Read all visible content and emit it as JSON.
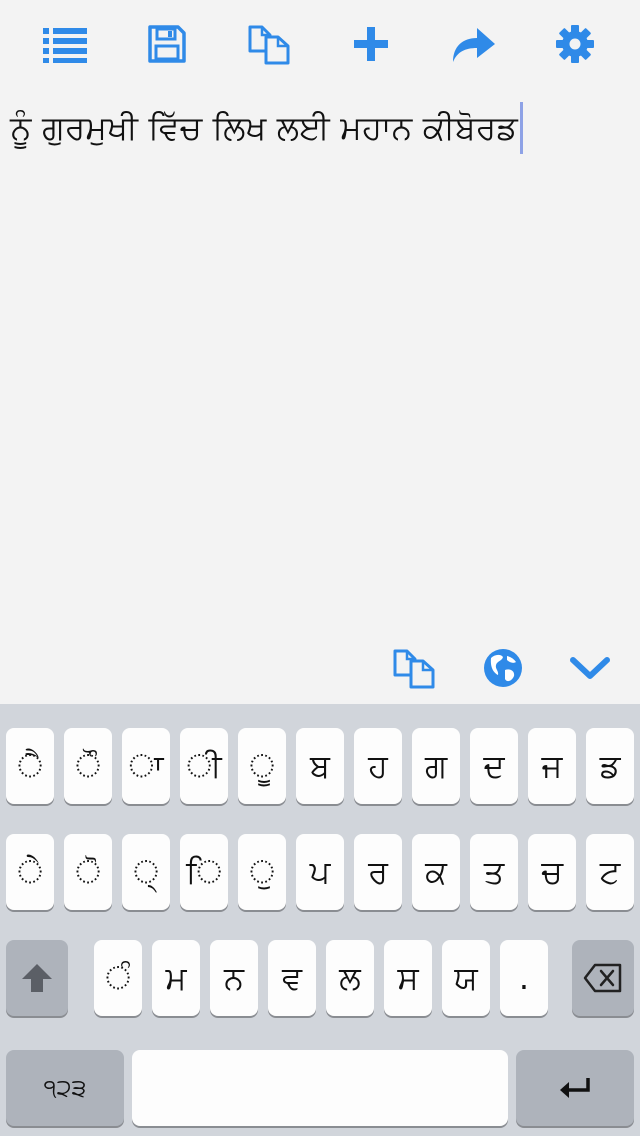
{
  "toolbar": {
    "icons": [
      "list-icon",
      "save-icon",
      "copy-icon",
      "plus-icon",
      "share-icon",
      "gear-icon"
    ],
    "accent": "#2f8ae8"
  },
  "editor": {
    "text": "ਨੂੰ ਗੁਰਮੁਖੀ ਵਿੱਚ ਲਿਖ ਲਈ ਮਹਾਨ ਕੀਬੋਰਡ"
  },
  "accessory": {
    "icons": [
      "copy-icon",
      "globe-icon",
      "chevron-down-icon"
    ]
  },
  "keyboard": {
    "row1": [
      "ੈ",
      "ੌ",
      "ਾ",
      "ੀ",
      "ੂ",
      "ਬ",
      "ਹ",
      "ਗ",
      "ਦ",
      "ਜ",
      "ਡ"
    ],
    "row2": [
      "ੇ",
      "ੋ",
      "੍",
      "ਿ",
      "ੁ",
      "ਪ",
      "ਰ",
      "ਕ",
      "ਤ",
      "ਚ",
      "ਟ"
    ],
    "row3": [
      "ੰ",
      "ਮ",
      "ਨ",
      "ਵ",
      "ਲ",
      "ਸ",
      "ਯ",
      "."
    ],
    "numbers_label": "੧੨੩",
    "space_label": "",
    "colors": {
      "key": "#fdfdfd",
      "special_key": "#aeb3bb",
      "background": "#d1d5db"
    }
  }
}
